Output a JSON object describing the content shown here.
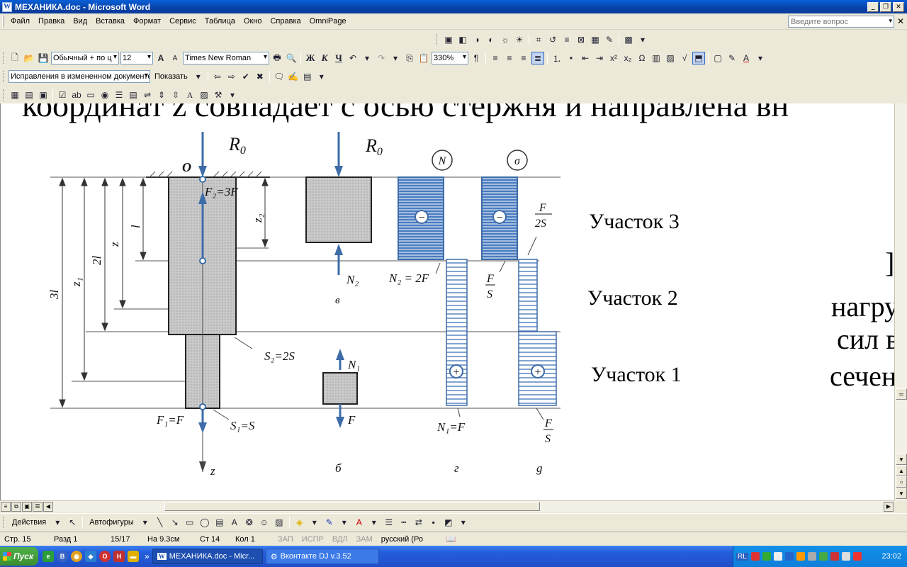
{
  "window": {
    "title": "МЕХАНИКА.doc - Microsoft Word",
    "icon_letter": "W"
  },
  "menu": {
    "items": [
      "Файл",
      "Правка",
      "Вид",
      "Вставка",
      "Формат",
      "Сервис",
      "Таблица",
      "Окно",
      "Справка",
      "OmniPage"
    ],
    "help_placeholder": "Введите вопрос"
  },
  "formatting": {
    "style": "Обычный + по ц",
    "size": "12",
    "font": "Times New Roman",
    "zoom": "330%",
    "bold": "Ж",
    "italic": "К",
    "underline": "Ч",
    "omega": "Ω"
  },
  "review": {
    "mode": "Исправления в измененном документе",
    "show": "Показать"
  },
  "document": {
    "top_text": "координат z совпадает с осью стержня и направлена вн",
    "section_3": "Участок 3",
    "section_2": "Участок 2",
    "section_1": "Участок 1",
    "right_frag_1": "]",
    "right_frag_2": "нагру",
    "right_frag_3": "сил в",
    "right_frag_4": "сечен",
    "figure": {
      "R0_a": "R",
      "R0_a_sub": "0",
      "R0_b": "R",
      "R0_b_sub": "0",
      "O": "O",
      "F2": "F₂=3F",
      "z2": "z₂",
      "l": "l",
      "z": "z",
      "twol": "2l",
      "z1": "z₁",
      "threel": "3l",
      "S2": "S₂=2S",
      "F1": "F₁=F",
      "S1": "S₁=S",
      "zaxis": "z",
      "a": "а",
      "N2": "N₂",
      "v": "в",
      "N1": "N₁",
      "F": "F",
      "b": "б",
      "N_circle": "N",
      "sigma_circle": "σ",
      "N2eq": "N₂ = 2F",
      "FS_num": "F",
      "FS_den": "S",
      "F2S_num": "F",
      "F2S_den": "2S",
      "N1eq": "N₁=F",
      "FS2_num": "F",
      "FS2_den": "S",
      "g": "г",
      "d": "g",
      "minus": "−",
      "plus": "+"
    }
  },
  "drawing": {
    "actions": "Действия",
    "autoshapes": "Автофигуры"
  },
  "status": {
    "page": "Стр. 15",
    "section": "Разд 1",
    "pages": "15/17",
    "at": "На 9.3см",
    "line": "Ст 14",
    "col": "Кол 1",
    "rec": "ЗАП",
    "trk": "ИСПР",
    "ext": "ВДЛ",
    "ovr": "ЗАМ",
    "lang": "русский (Ро"
  },
  "taskbar": {
    "start": "Пуск",
    "task_word": "МЕХАНИКА.doc - Micr...",
    "task_vk": "Вконтакте DJ v.3.52",
    "lang": "RL",
    "time": "23:02"
  },
  "colors": {
    "title_bar": "#0842a8",
    "diagram_blue": "#3d6ca8",
    "hatch": "#5a86c0",
    "taskbar": "#245edb"
  }
}
